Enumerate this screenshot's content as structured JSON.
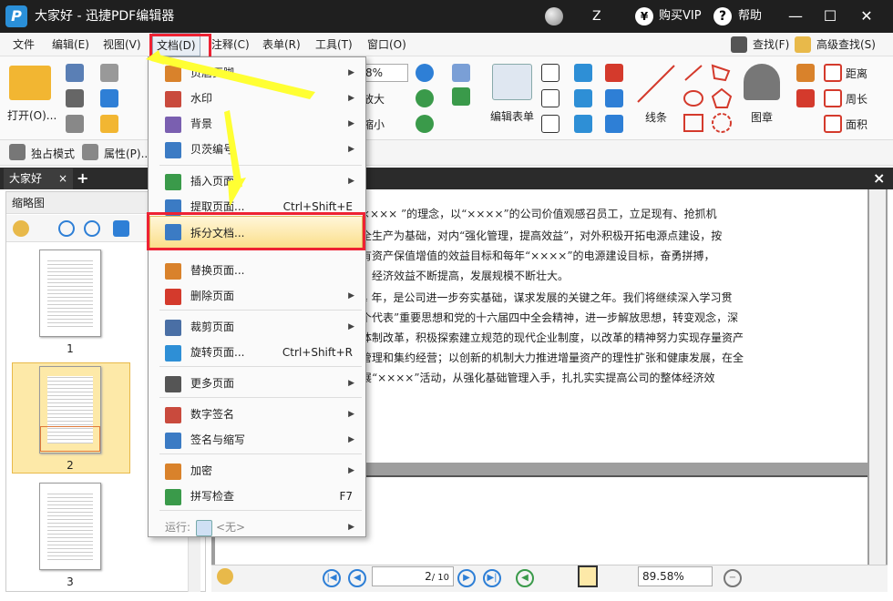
{
  "titlebar": {
    "title": "大家好 - 迅捷PDF编辑器",
    "user": "Z",
    "vip": "购买VIP",
    "help": "帮助",
    "vip_icon": "¥",
    "help_icon": "?",
    "logo": "P"
  },
  "menu": [
    "文件",
    "编辑(E)",
    "视图(V)",
    "文档(D)",
    "注释(C)",
    "表单(R)",
    "工具(T)",
    "窗口(O)"
  ],
  "menu_right": {
    "find": "查找(F)",
    "adv_find": "高级查找(S)"
  },
  "toolbar": {
    "open": "打开(O)...",
    "zoom": "8%",
    "zoom_in": "放大",
    "zoom_out": "缩小",
    "edit_form": "编辑表单",
    "line": "线条",
    "stamp": "图章",
    "distance": "距离",
    "perimeter": "周长",
    "area": "面积"
  },
  "toolbar2": {
    "exclusive": "独占模式",
    "properties": "属性(P)..."
  },
  "tab": {
    "name": "大家好",
    "close": "×",
    "add": "+",
    "panel_close": "×"
  },
  "thumbs": {
    "title": "缩略图",
    "pages": [
      "1",
      "2",
      "3"
    ]
  },
  "doc_lines": [
    "×××× ”的理念，以“××××”的公司价值观感召员工，立足现有、抢抓机",
    "全生产为基础，对内“强化管理，提高效益”，对外积极开拓电源点建设，按",
    "有资产保值增值的效益目标和每年“××××”的电源建设目标，奋勇拼搏，",
    "，经济效益不断提高，发展规模不断壮大。",
    "4 年，是公司进一步夯实基础，谋求发展的关键之年。我们将继续深入学习贯",
    "个代表”重要思想和党的十六届四中全会精神，进一步解放思想，转变观念，深",
    "体制改革，积极探索建立规范的现代企业制度，以改革的精神努力实现存量资产",
    "管理和集约经营；以创新的机制大力推进增量资产的理性扩张和健康发展，在全",
    "展“××××”活动，从强化基础管理入手，扎扎实实提高公司的整体经济效"
  ],
  "status": {
    "page": "2",
    "total": "/ 10",
    "zoom": "89.58%"
  },
  "dropdown": [
    {
      "label": "页眉页脚",
      "sc": "",
      "arrow": true,
      "color": "#d9822b"
    },
    {
      "label": "水印",
      "sc": "",
      "arrow": true,
      "color": "#c94a3d"
    },
    {
      "label": "背景",
      "sc": "",
      "arrow": true,
      "color": "#7a5fb0"
    },
    {
      "label": "贝茨编号",
      "sc": "",
      "arrow": true,
      "color": "#3b7bc4"
    },
    {
      "label": "插入页面",
      "sc": "",
      "arrow": true,
      "color": "#3a9a4a"
    },
    {
      "label": "提取页面...",
      "sc": "Ctrl+Shift+E",
      "arrow": false,
      "color": "#3b7bc4"
    },
    {
      "label": "拆分文档...",
      "sc": "",
      "arrow": false,
      "color": "#3b7bc4"
    },
    {
      "label": "替换页面...",
      "sc": "",
      "arrow": false,
      "color": "#d9822b"
    },
    {
      "label": "删除页面",
      "sc": "",
      "arrow": true,
      "color": "#d43a2c"
    },
    {
      "label": "裁剪页面",
      "sc": "",
      "arrow": true,
      "color": "#4a6fa5"
    },
    {
      "label": "旋转页面...",
      "sc": "Ctrl+Shift+R",
      "arrow": false,
      "color": "#2e8fd6"
    },
    {
      "label": "更多页面",
      "sc": "",
      "arrow": true,
      "color": "#555"
    },
    {
      "label": "数字签名",
      "sc": "",
      "arrow": true,
      "color": "#c94a3d"
    },
    {
      "label": "签名与缩写",
      "sc": "",
      "arrow": true,
      "color": "#3b7bc4"
    },
    {
      "label": "加密",
      "sc": "",
      "arrow": true,
      "color": "#d9822b"
    },
    {
      "label": "拼写检查",
      "sc": "F7",
      "arrow": false,
      "color": "#3a9a4a"
    }
  ],
  "run": {
    "label": "运行:",
    "value": "<无>"
  }
}
